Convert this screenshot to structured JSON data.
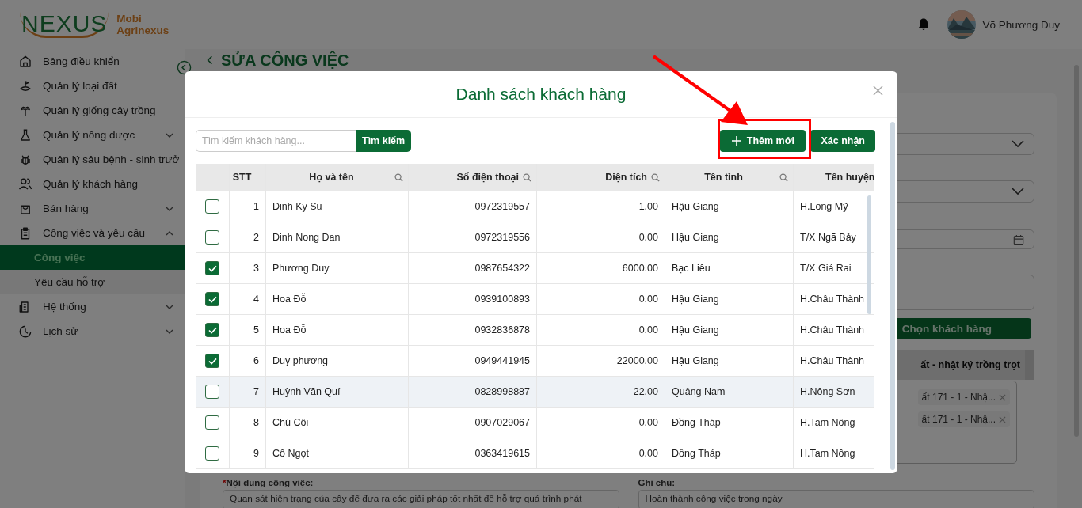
{
  "header": {
    "logo": {
      "mark": "NEXUS",
      "line1": "Mobi",
      "line2": "Agrinexus"
    },
    "user": {
      "name": "Võ Phương Duy"
    }
  },
  "sidebar": {
    "items": [
      {
        "label": "Bảng điều khiển"
      },
      {
        "label": "Quản lý loại đất"
      },
      {
        "label": "Quản lý giống cây trồng"
      },
      {
        "label": "Quản lý nông dược",
        "expanded": false
      },
      {
        "label": "Quản lý sâu bệnh - sinh trưở"
      },
      {
        "label": "Quản lý khách hàng"
      },
      {
        "label": "Bán hàng",
        "expanded": false
      },
      {
        "label": "Công việc và yêu cầu",
        "expanded": true,
        "children": [
          {
            "label": "Công việc",
            "selected": true
          },
          {
            "label": "Yêu cầu hỗ trợ",
            "selected": false
          }
        ]
      },
      {
        "label": "Hệ thống",
        "expanded": false
      },
      {
        "label": "Lịch sử",
        "expanded": false
      }
    ]
  },
  "page": {
    "title": "SỬA CÔNG VIỆC",
    "select_customer_button": "Chọn khách hàng",
    "tab_label": "ất - nhật ký trồng trọt",
    "tags": [
      {
        "label": "ất 171 - 1 - Nhậ..."
      },
      {
        "label": "ất 171 - 1 - Nhậ..."
      }
    ],
    "content_label": "Nội dung công việc:",
    "required_mark": "*",
    "content_value": "Quan sát hiện trạng của cây để đưa ra các giải pháp tốt nhất để hỗ trợ quá trình phát",
    "note_label": "Ghi chú:",
    "note_value": "Hoàn thành công việc trong ngày"
  },
  "modal": {
    "title": "Danh sách khách hàng",
    "search": {
      "placeholder": "Tìm kiếm khách hàng...",
      "button": "Tìm kiếm"
    },
    "add_button": "Thêm mới",
    "confirm_button": "Xác nhận",
    "table": {
      "columns": [
        "STT",
        "Họ và tên",
        "Số điện thoại",
        "Diện tích",
        "Tên tỉnh",
        "Tên huyện"
      ],
      "rows": [
        {
          "checked": false,
          "highlighted": false,
          "cells": [
            "1",
            "Dinh Ky Su",
            "0972319557",
            "1.00",
            "Hậu Giang",
            "H.Long Mỹ"
          ]
        },
        {
          "checked": false,
          "highlighted": false,
          "cells": [
            "2",
            "Dinh Nong Dan",
            "0972319556",
            "0.00",
            "Hậu Giang",
            "T/X Ngã Bảy"
          ]
        },
        {
          "checked": true,
          "highlighted": false,
          "cells": [
            "3",
            "Phương Duy",
            "0987654322",
            "6000.00",
            "Bạc Liêu",
            "T/X Giá Rai"
          ]
        },
        {
          "checked": true,
          "highlighted": false,
          "cells": [
            "4",
            "Hoa Đỗ",
            "0939100893",
            "0.00",
            "Hậu Giang",
            "H.Châu Thành"
          ]
        },
        {
          "checked": true,
          "highlighted": false,
          "cells": [
            "5",
            "Hoa Đỗ",
            "0932836878",
            "0.00",
            "Hậu Giang",
            "H.Châu Thành"
          ]
        },
        {
          "checked": true,
          "highlighted": false,
          "cells": [
            "6",
            "Duy phương",
            "0949441945",
            "22000.00",
            "Hậu Giang",
            "H.Châu Thành"
          ]
        },
        {
          "checked": false,
          "highlighted": true,
          "cells": [
            "7",
            "Huỳnh Văn Quí",
            "0828998887",
            "22.00",
            "Quảng Nam",
            "H.Nông Sơn"
          ]
        },
        {
          "checked": false,
          "highlighted": false,
          "cells": [
            "8",
            "Chú Côi",
            "0907029067",
            "0.00",
            "Đồng Tháp",
            "H.Tam Nông"
          ]
        },
        {
          "checked": false,
          "highlighted": false,
          "cells": [
            "9",
            "Cô Ngọt",
            "0363419615",
            "0.00",
            "Đồng Tháp",
            "H.Tam Nông"
          ]
        }
      ]
    }
  },
  "annotation": {
    "arrow": true,
    "highlight_box": true
  }
}
